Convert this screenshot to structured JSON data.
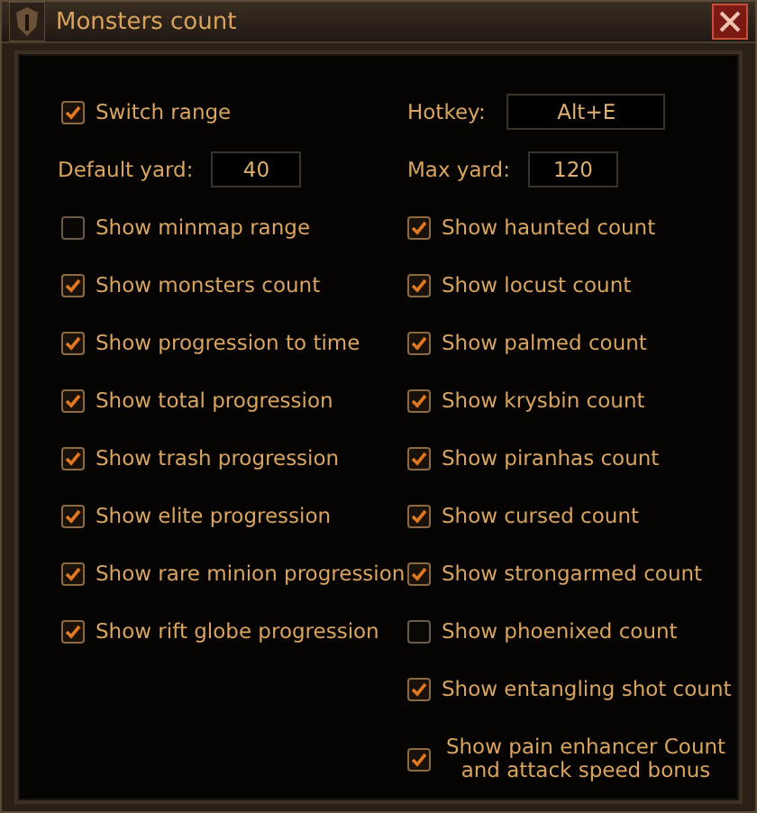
{
  "window": {
    "title": "Monsters count"
  },
  "switch_range": {
    "label": "Switch range",
    "checked": true
  },
  "hotkey": {
    "label": "Hotkey:",
    "value": "Alt+E"
  },
  "default_yard": {
    "label": "Default yard:",
    "value": "40"
  },
  "max_yard": {
    "label": "Max yard:",
    "value": "120"
  },
  "left_options": [
    {
      "label": "Show minmap range",
      "checked": false
    },
    {
      "label": "Show monsters count",
      "checked": true
    },
    {
      "label": "Show progression to time",
      "checked": true
    },
    {
      "label": "Show total progression",
      "checked": true
    },
    {
      "label": "Show trash progression",
      "checked": true
    },
    {
      "label": "Show elite progression",
      "checked": true
    },
    {
      "label": "Show rare minion progression",
      "checked": true
    },
    {
      "label": "Show rift globe progression",
      "checked": true
    }
  ],
  "right_options": [
    {
      "label": "Show haunted count",
      "checked": true
    },
    {
      "label": "Show locust count",
      "checked": true
    },
    {
      "label": "Show palmed count",
      "checked": true
    },
    {
      "label": "Show krysbin count",
      "checked": true
    },
    {
      "label": "Show piranhas count",
      "checked": true
    },
    {
      "label": "Show cursed count",
      "checked": true
    },
    {
      "label": "Show strongarmed count",
      "checked": true
    },
    {
      "label": "Show phoenixed count",
      "checked": false
    },
    {
      "label": "Show entangling shot count",
      "checked": true
    },
    {
      "label": "Show pain enhancer Count and attack speed bonus",
      "checked": true
    }
  ]
}
